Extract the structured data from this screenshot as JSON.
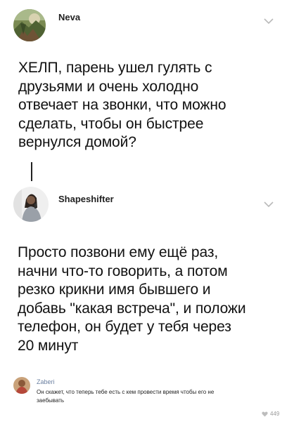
{
  "post1": {
    "author": "Neva",
    "lines": [
      "ХЕЛП, парень ушел гулять с",
      "друзьями и очень холодно",
      "отвечает на звонки, что можно",
      "сделать, чтобы он быстрее",
      "вернулся домой?"
    ]
  },
  "post2": {
    "author": "Shapeshifter",
    "lines": [
      "Просто позвони ему ещё раз,",
      "начни что-то говорить, а потом",
      "резко крикни имя бывшего и",
      "добавь \"какая встреча\", и положи",
      "телефон, он будет у тебя через",
      "20 минут"
    ]
  },
  "comment": {
    "author": "Zaberi",
    "lines": [
      "Он скажет, что теперь тебе есть с кем провести время чтобы его не",
      "заебывать"
    ],
    "likes": "449"
  },
  "icons": {
    "chevron": "chevron-down-icon",
    "heart": "heart-icon"
  }
}
